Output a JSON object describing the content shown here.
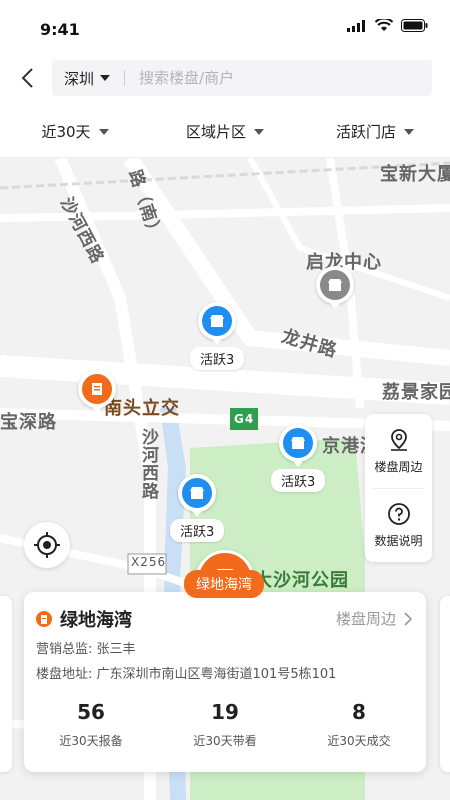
{
  "status": {
    "time": "9:41"
  },
  "header": {
    "city": "深圳",
    "search_placeholder": "搜索楼盘/商户"
  },
  "filters": [
    {
      "label": "近30天"
    },
    {
      "label": "区域片区"
    },
    {
      "label": "活跃门店"
    }
  ],
  "map": {
    "labels": [
      {
        "text": "宝新大厦"
      },
      {
        "text": "路（南）"
      },
      {
        "text": "沙河西路"
      },
      {
        "text": "启龙中心"
      },
      {
        "text": "龙井路"
      },
      {
        "text": "荔景家园"
      },
      {
        "text": "南头立交"
      },
      {
        "text": "宝深路"
      },
      {
        "text": "京港澳"
      },
      {
        "text": "沙河西路"
      },
      {
        "text": "大沙河公园"
      },
      {
        "text": "X256"
      },
      {
        "text": "G4"
      }
    ],
    "pins": [
      {
        "label": "活跃3",
        "color": "#1f8ef1"
      },
      {
        "label": "活跃3",
        "color": "#1f8ef1"
      },
      {
        "label": "活跃3",
        "color": "#1f8ef1"
      }
    ],
    "colors": {
      "blue": "#1f8ef1",
      "orange": "#f26a1b",
      "grey": "#8a8a8a",
      "park": "#cdeec5"
    }
  },
  "side_tools": [
    {
      "label": "楼盘周边",
      "icon": "location-icon"
    },
    {
      "label": "数据说明",
      "icon": "help-icon"
    }
  ],
  "card": {
    "tag": "绿地海湾",
    "title": "绿地海湾",
    "nearby_link": "楼盘周边",
    "manager": "营销总监: 张三丰",
    "address": "楼盘地址: 广东深圳市南山区粤海街道101号5栋101",
    "stats": [
      {
        "value": "56",
        "label": "近30天报备"
      },
      {
        "value": "19",
        "label": "近30天带看"
      },
      {
        "value": "8",
        "label": "近30天成交"
      }
    ]
  }
}
